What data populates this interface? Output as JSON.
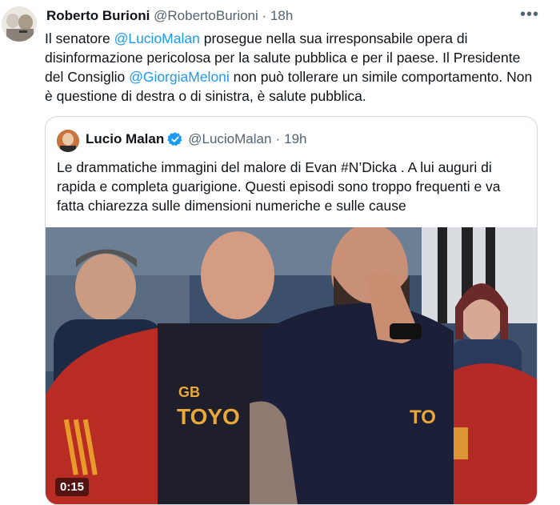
{
  "tweet": {
    "author_name": "Roberto Burioni",
    "author_handle": "@RobertoBurioni",
    "separator": "·",
    "time": "18h",
    "text_parts": [
      "Il senatore ",
      "@LucioMalan",
      " prosegue nella sua irresponsabile opera di disinformazione pericolosa per la salute pubblica e per il paese. Il Presidente del Consiglio ",
      "@GiorgiaMeloni",
      " non può tollerare un simile comportamento. Non è questione di destra o di sinistra, è salute pubblica."
    ],
    "more_icon": "more-dots-icon"
  },
  "quoted_tweet": {
    "author_name": "Lucio Malan",
    "author_handle": "@LucioMalan",
    "separator": "·",
    "time": "19h",
    "verified_icon": "verified-badge-icon",
    "text": "Le drammatiche immagini del malore di Evan #N’Dicka . A lui auguri di rapida e completa guarigione. Questi episodi sono troppo frequenti e va fatta chiarezza sulle dimensioni numeriche e sulle cause",
    "video": {
      "duration": "0:15",
      "shirt_initials": "GB",
      "shirt_sponsor": "TOYO",
      "shirt_sponsor_partial": "TO"
    }
  },
  "colors": {
    "link": "#1d9bf0",
    "text": "#0f1419",
    "muted": "#536471",
    "border": "#cfd9de",
    "verified": "#1d9bf0"
  }
}
